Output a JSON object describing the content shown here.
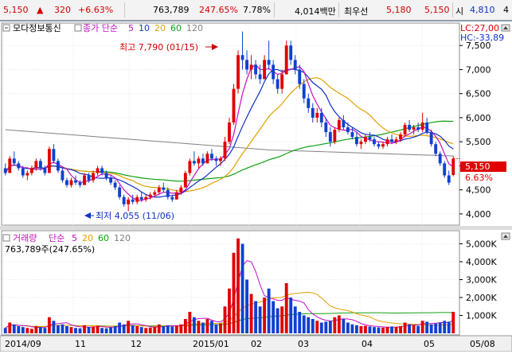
{
  "quote": {
    "price": "5,150",
    "change_arrow": "▲",
    "change": "320",
    "change_pct": "+6.63%",
    "volume": "763,789",
    "volume_ratio": "247.65%",
    "turnover": "7.78%",
    "amount": "4,014백만",
    "pref_label": "최우선",
    "ask": "5,180",
    "bid": "5,150",
    "open_label": "시",
    "open": "4,810",
    "open_extra": "4"
  },
  "price_panel": {
    "stock_name": "모다정보통신",
    "ma_label": "종가 단순",
    "ma_periods": [
      "5",
      "10",
      "20",
      "60",
      "120"
    ],
    "lc": "LC:27,00",
    "hc": "HC:-33,89",
    "high_annotation": "최고 7,790 (01/15)",
    "low_annotation": "최저 4,055 (11/06)",
    "current_price_tag": "5,150",
    "current_pct_tag": "6.63%",
    "y_ticks": [
      "7,500",
      "7,000",
      "6,500",
      "6,000",
      "5,500",
      "5,000",
      "4,500",
      "4,000"
    ]
  },
  "volume_panel": {
    "title": "거래량",
    "ma_label": "단순",
    "ma_periods": [
      "5",
      "20",
      "60",
      "120"
    ],
    "readout": "763,789주(247.65%)",
    "y_ticks": [
      "5,000K",
      "4,000K",
      "3,000K",
      "2,000K",
      "1,000K"
    ]
  },
  "x_axis": {
    "labels": [
      "2014/09",
      "11",
      "12",
      "2015/01",
      "02",
      "03",
      "04",
      "05",
      "05/08"
    ]
  },
  "colors": {
    "up": "#e00000",
    "down": "#1040d0",
    "ma5": "#c010c0",
    "ma10": "#1030c8",
    "ma20": "#e0a000",
    "ma60": "#10a010",
    "ma120": "#808080"
  },
  "chart_data": {
    "type": "candlestick",
    "price_range": [
      3800,
      7900
    ],
    "volume_range_k": [
      0,
      5600
    ],
    "ohlc": [
      [
        4950,
        5050,
        4800,
        4850
      ],
      [
        4850,
        5200,
        4850,
        5150
      ],
      [
        5150,
        5300,
        5000,
        5050
      ],
      [
        5050,
        5100,
        4900,
        4950
      ],
      [
        4950,
        5000,
        4750,
        4800
      ],
      [
        4800,
        4900,
        4700,
        4850
      ],
      [
        4850,
        5000,
        4800,
        4950
      ],
      [
        4950,
        5150,
        4900,
        5100
      ],
      [
        5100,
        5150,
        4900,
        4950
      ],
      [
        4950,
        5000,
        4800,
        4850
      ],
      [
        4850,
        5400,
        4850,
        5350
      ],
      [
        5350,
        5450,
        5050,
        5100
      ],
      [
        5100,
        5150,
        4850,
        4900
      ],
      [
        4900,
        4950,
        4650,
        4700
      ],
      [
        4700,
        4750,
        4550,
        4600
      ],
      [
        4600,
        4750,
        4550,
        4700
      ],
      [
        4700,
        4800,
        4600,
        4650
      ],
      [
        4650,
        4700,
        4550,
        4600
      ],
      [
        4600,
        4850,
        4600,
        4800
      ],
      [
        4800,
        4850,
        4650,
        4700
      ],
      [
        4700,
        4900,
        4650,
        4850
      ],
      [
        4850,
        5000,
        4800,
        4950
      ],
      [
        4950,
        5000,
        4800,
        4850
      ],
      [
        4850,
        4900,
        4700,
        4750
      ],
      [
        4750,
        4800,
        4600,
        4650
      ],
      [
        4650,
        4700,
        4500,
        4550
      ],
      [
        4550,
        4600,
        4300,
        4350
      ],
      [
        4350,
        4400,
        4150,
        4200
      ],
      [
        4200,
        4350,
        4055,
        4300
      ],
      [
        4300,
        4400,
        4200,
        4250
      ],
      [
        4250,
        4400,
        4200,
        4350
      ],
      [
        4350,
        4450,
        4250,
        4300
      ],
      [
        4300,
        4400,
        4250,
        4350
      ],
      [
        4350,
        4450,
        4300,
        4400
      ],
      [
        4400,
        4500,
        4350,
        4450
      ],
      [
        4450,
        4600,
        4400,
        4550
      ],
      [
        4550,
        4650,
        4450,
        4500
      ],
      [
        4500,
        4550,
        4300,
        4350
      ],
      [
        4350,
        4400,
        4250,
        4300
      ],
      [
        4300,
        4500,
        4300,
        4450
      ],
      [
        4450,
        4600,
        4400,
        4550
      ],
      [
        4550,
        4900,
        4550,
        4850
      ],
      [
        4850,
        5150,
        4800,
        5100
      ],
      [
        5100,
        5300,
        5000,
        5050
      ],
      [
        5050,
        5200,
        4950,
        5150
      ],
      [
        5150,
        5250,
        5000,
        5050
      ],
      [
        5050,
        5300,
        5050,
        5250
      ],
      [
        5250,
        5350,
        5100,
        5150
      ],
      [
        5150,
        5200,
        5000,
        5100
      ],
      [
        5100,
        5200,
        5000,
        5150
      ],
      [
        5150,
        5600,
        5100,
        5500
      ],
      [
        5500,
        6000,
        5450,
        5900
      ],
      [
        5900,
        6700,
        5850,
        6600
      ],
      [
        6600,
        7400,
        6500,
        7300
      ],
      [
        7300,
        7790,
        7000,
        7200
      ],
      [
        7200,
        7400,
        6900,
        7000
      ],
      [
        7000,
        7300,
        6800,
        7100
      ],
      [
        7100,
        7200,
        6800,
        6900
      ],
      [
        6900,
        7100,
        6700,
        6800
      ],
      [
        6800,
        7300,
        6800,
        7200
      ],
      [
        7200,
        7600,
        7000,
        7100
      ],
      [
        7100,
        7200,
        6700,
        6800
      ],
      [
        6800,
        6900,
        6500,
        6600
      ],
      [
        6600,
        7000,
        6500,
        6900
      ],
      [
        6900,
        7600,
        6900,
        7500
      ],
      [
        7500,
        7600,
        7100,
        7200
      ],
      [
        7200,
        7300,
        6900,
        7000
      ],
      [
        7000,
        7100,
        6600,
        6700
      ],
      [
        6700,
        6800,
        6300,
        6400
      ],
      [
        6400,
        6500,
        6100,
        6200
      ],
      [
        6200,
        6300,
        5900,
        6000
      ],
      [
        6000,
        6200,
        5900,
        6100
      ],
      [
        6100,
        6200,
        5800,
        5900
      ],
      [
        5900,
        6000,
        5600,
        5700
      ],
      [
        5700,
        5800,
        5400,
        5500
      ],
      [
        5500,
        5800,
        5450,
        5750
      ],
      [
        5750,
        6000,
        5700,
        5950
      ],
      [
        5950,
        6050,
        5750,
        5800
      ],
      [
        5800,
        5900,
        5650,
        5700
      ],
      [
        5700,
        5800,
        5550,
        5600
      ],
      [
        5600,
        5700,
        5400,
        5450
      ],
      [
        5450,
        5550,
        5350,
        5500
      ],
      [
        5500,
        5650,
        5450,
        5600
      ],
      [
        5600,
        5700,
        5500,
        5550
      ],
      [
        5550,
        5600,
        5400,
        5450
      ],
      [
        5450,
        5500,
        5350,
        5400
      ],
      [
        5400,
        5500,
        5350,
        5450
      ],
      [
        5450,
        5600,
        5400,
        5550
      ],
      [
        5550,
        5650,
        5450,
        5500
      ],
      [
        5500,
        5600,
        5450,
        5550
      ],
      [
        5550,
        5700,
        5500,
        5650
      ],
      [
        5650,
        5900,
        5600,
        5850
      ],
      [
        5850,
        5950,
        5700,
        5750
      ],
      [
        5750,
        5850,
        5650,
        5800
      ],
      [
        5800,
        5900,
        5700,
        5750
      ],
      [
        5750,
        6100,
        5700,
        5900
      ],
      [
        5900,
        6000,
        5650,
        5700
      ],
      [
        5700,
        5750,
        5400,
        5450
      ],
      [
        5450,
        5500,
        5200,
        5250
      ],
      [
        5250,
        5300,
        5000,
        5050
      ],
      [
        5050,
        5100,
        4750,
        4800
      ],
      [
        4800,
        4900,
        4600,
        4650
      ],
      [
        4810,
        5200,
        4780,
        5150
      ]
    ],
    "volume_k": [
      300,
      600,
      500,
      400,
      350,
      300,
      250,
      400,
      350,
      300,
      900,
      700,
      450,
      500,
      400,
      350,
      300,
      280,
      450,
      350,
      380,
      420,
      300,
      280,
      330,
      400,
      600,
      500,
      700,
      450,
      400,
      350,
      300,
      320,
      350,
      500,
      400,
      450,
      380,
      420,
      500,
      800,
      1200,
      900,
      700,
      600,
      800,
      700,
      500,
      550,
      1500,
      2500,
      4500,
      5300,
      5000,
      3000,
      2200,
      1800,
      1500,
      2000,
      2500,
      1800,
      1400,
      1500,
      2800,
      2000,
      1500,
      1200,
      1000,
      900,
      800,
      700,
      600,
      650,
      700,
      900,
      1000,
      800,
      600,
      500,
      450,
      400,
      420,
      380,
      350,
      330,
      320,
      350,
      380,
      360,
      400,
      600,
      500,
      450,
      420,
      700,
      650,
      500,
      550,
      600,
      700,
      650,
      1200
    ]
  }
}
